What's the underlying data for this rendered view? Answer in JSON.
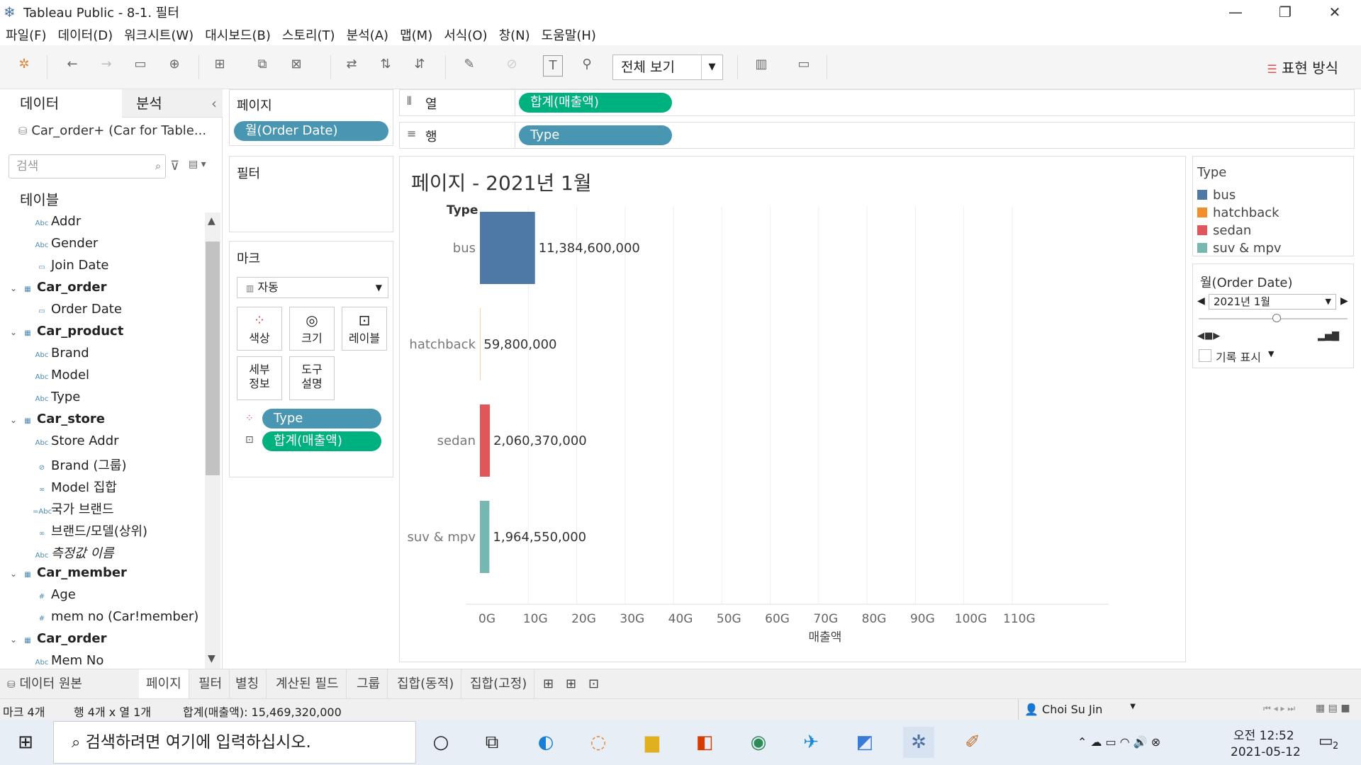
{
  "window": {
    "title": "Tableau Public - 8-1. 필터",
    "minimize": "—",
    "restore": "❐",
    "close": "✕"
  },
  "menu": [
    "파일(F)",
    "데이터(D)",
    "워크시트(W)",
    "대시보드(B)",
    "스토리(T)",
    "분석(A)",
    "맵(M)",
    "서식(O)",
    "창(N)",
    "도움말(H)"
  ],
  "toolbar": {
    "fit": "전체 보기",
    "showme": "표현 방식"
  },
  "left": {
    "tab_data": "데이터",
    "tab_analysis": "분석",
    "collapse": "‹",
    "datasource": "Car_order+ (Car for Table...",
    "search_placeholder": "검색",
    "tables_header": "테이블",
    "fields": [
      {
        "icon": "Abc",
        "label": "Addr",
        "bold": false
      },
      {
        "icon": "Abc",
        "label": "Gender",
        "bold": false
      },
      {
        "icon": "▭",
        "label": "Join Date",
        "bold": false
      },
      {
        "icon": "▦",
        "label": "Car_order",
        "bold": true,
        "caret": "⌄"
      },
      {
        "icon": "▭",
        "label": "Order Date",
        "bold": false
      },
      {
        "icon": "▦",
        "label": "Car_product",
        "bold": true,
        "caret": "⌄"
      },
      {
        "icon": "Abc",
        "label": "Brand",
        "bold": false
      },
      {
        "icon": "Abc",
        "label": "Model",
        "bold": false
      },
      {
        "icon": "Abc",
        "label": "Type",
        "bold": false
      },
      {
        "icon": "▦",
        "label": "Car_store",
        "bold": true,
        "caret": "⌄"
      },
      {
        "icon": "Abc",
        "label": "Store Addr",
        "bold": false
      },
      {
        "icon": "⊘",
        "label": "Brand (그룹)",
        "bold": false
      },
      {
        "icon": "∞",
        "label": "Model 집합",
        "bold": false
      },
      {
        "icon": "=Abc",
        "label": "국가 브랜드",
        "bold": false
      },
      {
        "icon": "∞",
        "label": "브랜드/모델(상위)",
        "bold": false
      },
      {
        "icon": "Abc",
        "label": "측정값 이름",
        "bold": false,
        "italic": true
      },
      {
        "icon": "▦",
        "label": "Car_member",
        "bold": true,
        "caret": "⌄"
      },
      {
        "icon": "#",
        "label": "Age",
        "bold": false
      },
      {
        "icon": "#",
        "label": "mem no (Car!member)",
        "bold": false
      },
      {
        "icon": "▦",
        "label": "Car_order",
        "bold": true,
        "caret": "⌄"
      },
      {
        "icon": "Abc",
        "label": "Mem No",
        "bold": false
      }
    ]
  },
  "shelves": {
    "pages_label": "페이지",
    "pages_pill": "월(Order Date)",
    "filters_label": "필터",
    "marks_label": "마크",
    "marks_type": "자동",
    "mk_color": "색상",
    "mk_size": "크기",
    "mk_label": "레이블",
    "mk_detail": "세부\n정보",
    "mk_tooltip": "도구\n설명",
    "mk_pill1": "Type",
    "mk_pill2": "합계(매출액)",
    "columns_label": "열",
    "columns_pill": "합계(매출액)",
    "rows_label": "행",
    "rows_pill": "Type"
  },
  "viz": {
    "title": "페이지 - 2021년 1월",
    "row_header": "Type",
    "xlabel": "매출액"
  },
  "chart_data": {
    "type": "bar",
    "orientation": "horizontal",
    "categories": [
      "bus",
      "hatchback",
      "sedan",
      "suv & mpv"
    ],
    "values": [
      11384600000,
      59800000,
      2060370000,
      1964550000
    ],
    "value_labels": [
      "11,384,600,000",
      "59,800,000",
      "2,060,370,000",
      "1,964,550,000"
    ],
    "colors": [
      "#4e79a7",
      "#f28e2b",
      "#e15759",
      "#76b7b2"
    ],
    "xticks": [
      "0G",
      "10G",
      "20G",
      "30G",
      "40G",
      "50G",
      "60G",
      "70G",
      "80G",
      "90G",
      "100G",
      "110G"
    ],
    "xlim": [
      0,
      115000000000
    ],
    "grid": true,
    "title": "페이지 - 2021년 1월",
    "xlabel": "매출액",
    "ylabel": "Type"
  },
  "legend": {
    "title": "Type",
    "items": [
      {
        "label": "bus",
        "color": "#4e79a7"
      },
      {
        "label": "hatchback",
        "color": "#f28e2b"
      },
      {
        "label": "sedan",
        "color": "#e15759"
      },
      {
        "label": "suv & mpv",
        "color": "#76b7b2"
      }
    ]
  },
  "page_control": {
    "title": "월(Order Date)",
    "value": "2021년 1월",
    "history": "기록 표시"
  },
  "bottom_tabs": [
    "데이터 원본",
    "페이지",
    "필터",
    "별칭",
    "계산된 필드",
    "그룹",
    "집합(동적)",
    "집합(고정)"
  ],
  "status": {
    "marks": "마크 4개",
    "rowscols": "행 4개 x 열 1개",
    "sum": "합계(매출액): 15,469,320,000",
    "user": "Choi Su Jin"
  },
  "taskbar": {
    "search": "검색하려면 여기에 입력하십시오.",
    "time": "오전 12:52",
    "date": "2021-05-12",
    "notif": "2"
  }
}
